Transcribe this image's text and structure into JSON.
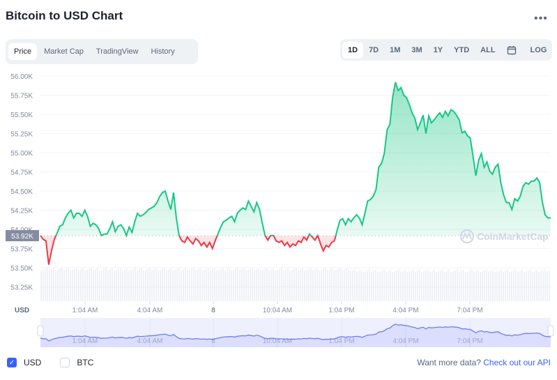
{
  "header": {
    "title": "Bitcoin to USD Chart",
    "more_icon": "more-horizontal-icon"
  },
  "tabs": [
    {
      "label": "Price",
      "active": true
    },
    {
      "label": "Market Cap"
    },
    {
      "label": "TradingView"
    },
    {
      "label": "History"
    }
  ],
  "ranges": [
    {
      "label": "1D",
      "active": true
    },
    {
      "label": "7D"
    },
    {
      "label": "1M"
    },
    {
      "label": "3M"
    },
    {
      "label": "1Y"
    },
    {
      "label": "YTD"
    },
    {
      "label": "ALL"
    }
  ],
  "calendar_icon": "calendar-icon",
  "log_label": "LOG",
  "watermark": "CoinMarketCap",
  "footer": {
    "usd_label": "USD",
    "usd_checked": true,
    "btc_label": "BTC",
    "btc_checked": false,
    "prompt": "Want more data?",
    "api_link": "Check out our API"
  },
  "colors": {
    "up": "#16c784",
    "down": "#ea3943",
    "navigator": "#6f7cf5",
    "accent": "#3861fb"
  },
  "chart_data": {
    "type": "line",
    "title": "",
    "ylabel": "USD",
    "ylim": [
      53100,
      56080
    ],
    "y_ticks": [
      "56.00K",
      "55.75K",
      "55.50K",
      "55.25K",
      "55.00K",
      "54.75K",
      "54.50K",
      "54.25K",
      "54.00K",
      "53.75K",
      "53.50K",
      "53.25K"
    ],
    "x_ticks": [
      "1:04 AM",
      "4:04 AM",
      "8",
      "10:04 AM",
      "1:04 PM",
      "4:04 PM",
      "7:04 PM"
    ],
    "baseline_label": "53.92K",
    "baseline": 53918,
    "grid": true,
    "values": [
      53920,
      53870,
      53850,
      53540,
      53720,
      53870,
      53950,
      54040,
      54060,
      54150,
      54210,
      54250,
      54150,
      54210,
      54210,
      54170,
      54250,
      54170,
      54040,
      54080,
      54060,
      54010,
      53920,
      53940,
      53940,
      54010,
      54100,
      53970,
      54040,
      54060,
      54010,
      53920,
      54030,
      53960,
      54100,
      54210,
      54170,
      54190,
      54220,
      54260,
      54280,
      54300,
      54350,
      54430,
      54480,
      54500,
      54370,
      54260,
      54480,
      54150,
      53920,
      53850,
      53830,
      53900,
      53850,
      53810,
      53880,
      53850,
      53790,
      53830,
      53770,
      53830,
      53750,
      53850,
      53940,
      54030,
      54100,
      54120,
      54150,
      54170,
      54100,
      54210,
      54250,
      54280,
      54260,
      54370,
      54300,
      54230,
      54350,
      54260,
      54080,
      53920,
      53860,
      53920,
      53920,
      53850,
      53830,
      53850,
      53790,
      53830,
      53770,
      53810,
      53790,
      53850,
      53830,
      53900,
      53860,
      53940,
      53900,
      53860,
      53920,
      53810,
      53720,
      53790,
      53770,
      53830,
      53850,
      53990,
      54120,
      54140,
      54060,
      54140,
      54100,
      54150,
      54190,
      54150,
      54060,
      54210,
      54370,
      54390,
      54430,
      54520,
      54810,
      54860,
      54990,
      55300,
      55370,
      55720,
      55920,
      55810,
      55850,
      55750,
      55720,
      55630,
      55520,
      55450,
      55300,
      55390,
      55490,
      55250,
      55480,
      55390,
      55430,
      55480,
      55520,
      55460,
      55540,
      55480,
      55560,
      55540,
      55490,
      55430,
      55260,
      55280,
      55220,
      55190,
      54950,
      54700,
      54900,
      54990,
      54810,
      54880,
      54760,
      54720,
      54810,
      54850,
      54610,
      54450,
      54350,
      54350,
      54260,
      54400,
      54370,
      54430,
      54560,
      54610,
      54590,
      54630,
      54630,
      54670,
      54610,
      54350,
      54190,
      54150,
      54150
    ]
  }
}
